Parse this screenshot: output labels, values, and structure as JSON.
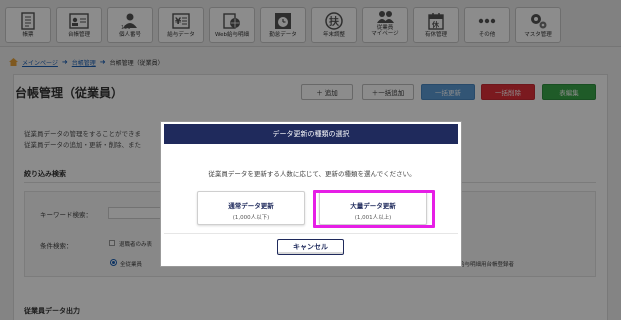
{
  "toolbar": {
    "items": [
      {
        "label": "帳票",
        "icon": "document-icon"
      },
      {
        "label": "台帳管理",
        "icon": "ledger-icon"
      },
      {
        "label": "個人番号",
        "icon": "id-number-icon"
      },
      {
        "label": "給与データ",
        "icon": "salary-data-icon"
      },
      {
        "label": "Web給与明細",
        "icon": "web-payslip-icon"
      },
      {
        "label": "勤怠データ",
        "icon": "attendance-icon"
      },
      {
        "label": "年末調整",
        "icon": "year-end-icon"
      },
      {
        "label": "従業員\nマイページ",
        "icon": "employee-mypage-icon"
      },
      {
        "label": "有休管理",
        "icon": "paid-leave-icon"
      },
      {
        "label": "その他",
        "icon": "more-icon"
      },
      {
        "label": "マスタ管理",
        "icon": "master-settings-icon"
      }
    ]
  },
  "breadcrumb": {
    "home": "メインページ",
    "ledger": "台帳管理",
    "current": "台帳管理（従業員）"
  },
  "page": {
    "title": "台帳管理（従業員）",
    "buttons": {
      "add": "＋ 追加",
      "bulk_add": "＋一括追加",
      "bulk_update": "一括更新",
      "bulk_delete": "一括削除",
      "table_edit": "表編集"
    },
    "description_line1": "従業員データの管理をすることができま",
    "description_line2": "従業員データの追加・更新・削除、また",
    "filter_section": "絞り込み検索",
    "keyword_label": "キーワード検索：",
    "condition_label": "条件検索：",
    "retired_checkbox": "退職者のみ表",
    "all_employees_radio": "全従業員",
    "right_note": "給与明細用台帳登録者",
    "output_section": "従業員データ出力"
  },
  "dialog": {
    "title": "データ更新の種類の選択",
    "message": "従業員データを更新する人数に応じて、更新の種類を選んでください。",
    "option_normal_title": "通常データ更新",
    "option_normal_sub": "(1,000人以下)",
    "option_bulk_title": "大量データ更新",
    "option_bulk_sub": "(1,001人以上)",
    "cancel": "キャンセル"
  },
  "colors": {
    "dialog_header": "#1f2a5c",
    "highlight": "#e61ee6",
    "bulk_update": "#5b9bd5",
    "bulk_delete": "#e0303a",
    "table_edit": "#3aa64a"
  }
}
